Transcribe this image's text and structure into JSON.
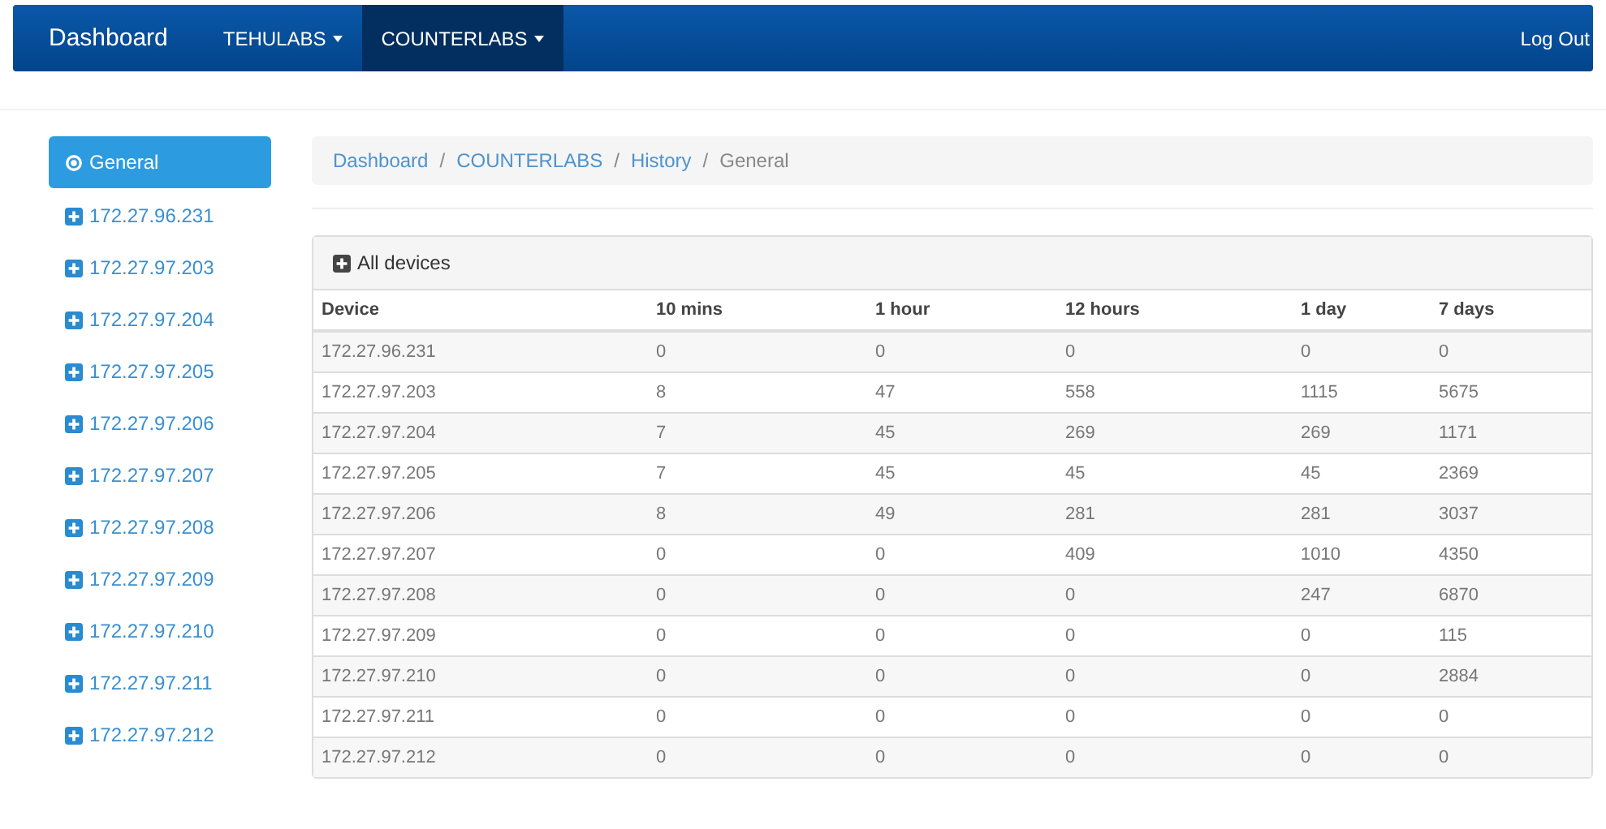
{
  "navbar": {
    "brand": "Dashboard",
    "menus": [
      {
        "label": "TEHULABS",
        "selected": false
      },
      {
        "label": "COUNTERLABS",
        "selected": true
      }
    ],
    "logout": "Log Out"
  },
  "sidebar": {
    "items": [
      {
        "label": "General",
        "kind": "circle",
        "selected": true
      },
      {
        "label": "172.27.96.231",
        "kind": "plus",
        "selected": false
      },
      {
        "label": "172.27.97.203",
        "kind": "plus",
        "selected": false
      },
      {
        "label": "172.27.97.204",
        "kind": "plus",
        "selected": false
      },
      {
        "label": "172.27.97.205",
        "kind": "plus",
        "selected": false
      },
      {
        "label": "172.27.97.206",
        "kind": "plus",
        "selected": false
      },
      {
        "label": "172.27.97.207",
        "kind": "plus",
        "selected": false
      },
      {
        "label": "172.27.97.208",
        "kind": "plus",
        "selected": false
      },
      {
        "label": "172.27.97.209",
        "kind": "plus",
        "selected": false
      },
      {
        "label": "172.27.97.210",
        "kind": "plus",
        "selected": false
      },
      {
        "label": "172.27.97.211",
        "kind": "plus",
        "selected": false
      },
      {
        "label": "172.27.97.212",
        "kind": "plus",
        "selected": false
      }
    ]
  },
  "breadcrumb": {
    "separator": "/",
    "items": [
      "Dashboard",
      "COUNTERLABS",
      "History",
      "General"
    ]
  },
  "panel": {
    "title": "All devices",
    "columns": [
      "Device",
      "10 mins",
      "1 hour",
      "12 hours",
      "1 day",
      "7 days"
    ],
    "rows": [
      [
        "172.27.96.231",
        "0",
        "0",
        "0",
        "0",
        "0"
      ],
      [
        "172.27.97.203",
        "8",
        "47",
        "558",
        "1115",
        "5675"
      ],
      [
        "172.27.97.204",
        "7",
        "45",
        "269",
        "269",
        "1171"
      ],
      [
        "172.27.97.205",
        "7",
        "45",
        "45",
        "45",
        "2369"
      ],
      [
        "172.27.97.206",
        "8",
        "49",
        "281",
        "281",
        "3037"
      ],
      [
        "172.27.97.207",
        "0",
        "0",
        "409",
        "1010",
        "4350"
      ],
      [
        "172.27.97.208",
        "0",
        "0",
        "0",
        "247",
        "6870"
      ],
      [
        "172.27.97.209",
        "0",
        "0",
        "0",
        "0",
        "115"
      ],
      [
        "172.27.97.210",
        "0",
        "0",
        "0",
        "0",
        "2884"
      ],
      [
        "172.27.97.211",
        "0",
        "0",
        "0",
        "0",
        "0"
      ],
      [
        "172.27.97.212",
        "0",
        "0",
        "0",
        "0",
        "0"
      ]
    ]
  }
}
